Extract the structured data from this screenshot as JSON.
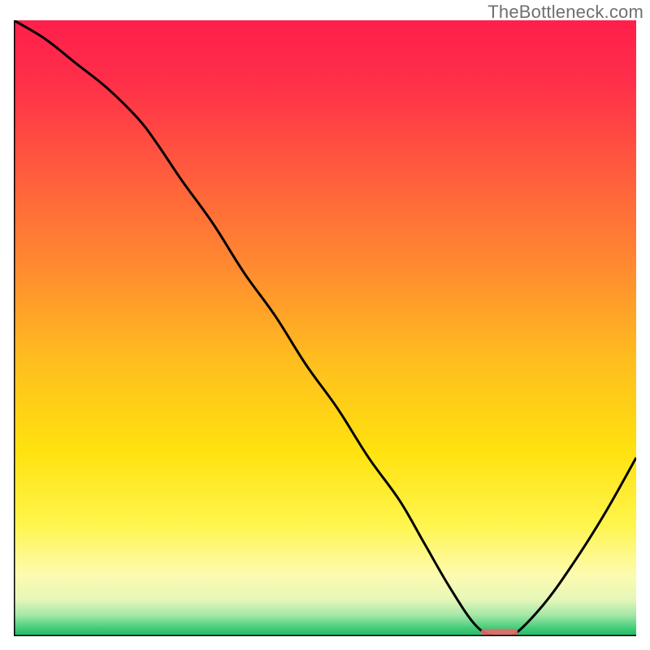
{
  "watermark": "TheBottleneck.com",
  "colors": {
    "gradient_stops": [
      {
        "offset": 0.0,
        "color": "#ff1f4b"
      },
      {
        "offset": 0.1,
        "color": "#ff2f49"
      },
      {
        "offset": 0.25,
        "color": "#ff5d3d"
      },
      {
        "offset": 0.4,
        "color": "#ff8a30"
      },
      {
        "offset": 0.55,
        "color": "#ffbd1f"
      },
      {
        "offset": 0.7,
        "color": "#ffe20f"
      },
      {
        "offset": 0.82,
        "color": "#fff54e"
      },
      {
        "offset": 0.9,
        "color": "#fdfbb0"
      },
      {
        "offset": 0.94,
        "color": "#e6f7b8"
      },
      {
        "offset": 0.965,
        "color": "#a7e8a8"
      },
      {
        "offset": 0.985,
        "color": "#4ccf7d"
      },
      {
        "offset": 1.0,
        "color": "#1bb765"
      }
    ],
    "curve": "#000000",
    "axis": "#000000",
    "marker": "#e46a6d",
    "marker_alpha": 0.9
  },
  "chart_data": {
    "type": "line",
    "title": "",
    "xlabel": "",
    "ylabel": "",
    "xlim": [
      0,
      100
    ],
    "ylim": [
      0,
      100
    ],
    "grid": false,
    "legend": false,
    "annotations": [],
    "series": [
      {
        "name": "bottleneck-curve",
        "x": [
          0,
          5,
          10,
          15,
          20,
          23,
          27,
          32,
          37,
          42,
          47,
          52,
          57,
          62,
          66,
          70,
          74,
          77,
          80,
          85,
          90,
          95,
          100
        ],
        "y": [
          100,
          97,
          93,
          89,
          84,
          80,
          74,
          67,
          59,
          52,
          44,
          37,
          29,
          22,
          15,
          8,
          2,
          0,
          0,
          5,
          12,
          20,
          29
        ]
      }
    ],
    "marker": {
      "name": "optimal-range",
      "x_start": 75,
      "x_end": 81,
      "y": 0.6,
      "height_pct": 1.2
    }
  }
}
